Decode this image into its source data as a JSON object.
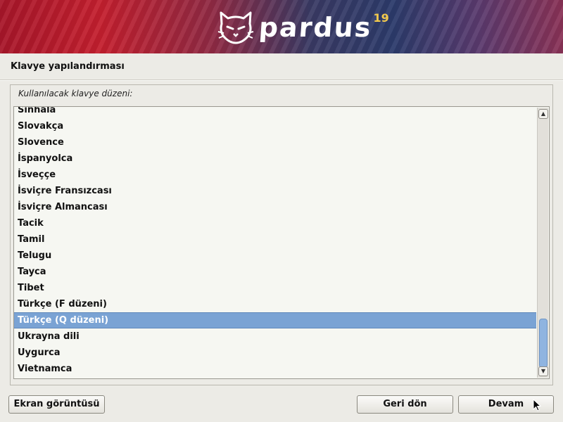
{
  "banner": {
    "logo_text": "pardus",
    "version": "19"
  },
  "step_title": "Klavye yapılandırması",
  "prompt": "Kullanılacak klavye düzeni:",
  "keyboard_layouts": [
    "Sinhala",
    "Slovakça",
    "Slovence",
    "İspanyolca",
    "İsveççe",
    "İsviçre Fransızcası",
    "İsviçre Almancası",
    "Tacik",
    "Tamil",
    "Telugu",
    "Tayca",
    "Tibet",
    "Türkçe (F düzeni)",
    "Türkçe (Q düzeni)",
    "Ukrayna dili",
    "Uygurca",
    "Vietnamca"
  ],
  "selected_layout": "Türkçe (Q düzeni)",
  "buttons": {
    "screenshot": "Ekran görüntüsü",
    "back": "Geri dön",
    "continue": "Devam"
  },
  "colors": {
    "selection": "#7aa3d4",
    "background": "#ecebe6"
  },
  "icons": {
    "logo": "cat-face-icon",
    "scroll_up": "arrow-up-icon",
    "scroll_down": "arrow-down-icon",
    "cursor": "mouse-pointer-icon"
  }
}
